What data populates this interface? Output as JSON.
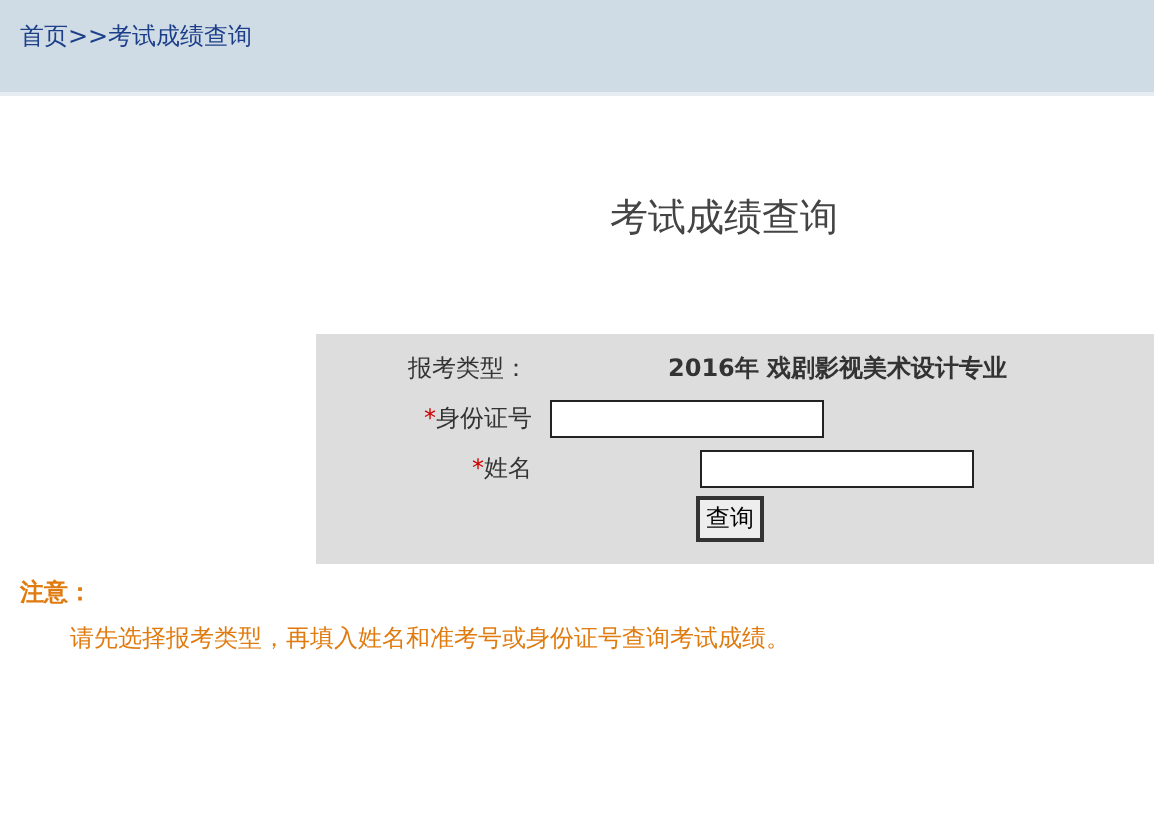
{
  "breadcrumb": "首页>>考试成绩查询",
  "title": "考试成绩查询",
  "form": {
    "exam_type": {
      "label": "报考类型：",
      "value": "2016年 戏剧影视美术设计专业"
    },
    "fields": [
      {
        "marker": "*",
        "label": "身份证号"
      },
      {
        "marker": "*",
        "label": "姓名"
      }
    ],
    "button": "查询"
  },
  "notice": {
    "heading": "注意：",
    "text": "请先选择报考类型，再填入姓名和准考号或身份证号查询考试成绩。"
  }
}
